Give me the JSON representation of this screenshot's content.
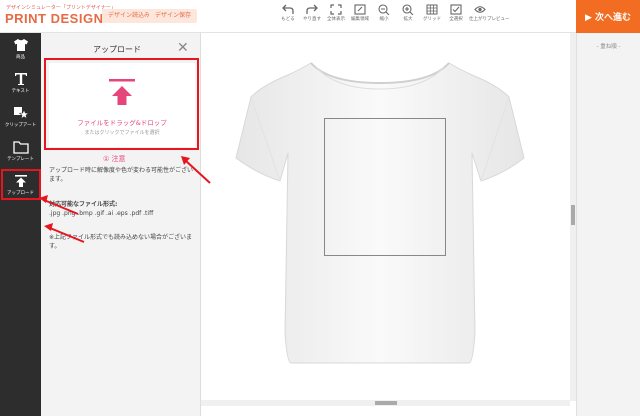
{
  "header": {
    "logo_sub": "デザインシミュレーター「プリントデザイナー」",
    "logo_main": "PRINT DESIGNER",
    "load_label": "デザイン読込み",
    "save_label": "デザイン保存",
    "next_label": "▶ 次へ進む"
  },
  "toolbar": [
    {
      "label": "もどる",
      "icon": "undo-icon"
    },
    {
      "label": "やり直す",
      "icon": "redo-icon"
    },
    {
      "label": "全体表示",
      "icon": "fit-icon"
    },
    {
      "label": "編集領域",
      "icon": "edit-area-icon"
    },
    {
      "label": "縮小",
      "icon": "zoom-out-icon"
    },
    {
      "label": "拡大",
      "icon": "zoom-in-icon"
    },
    {
      "label": "グリッド",
      "icon": "grid-icon"
    },
    {
      "label": "全選択",
      "icon": "select-all-icon"
    },
    {
      "label": "仕上がりプレビュー",
      "icon": "preview-icon"
    }
  ],
  "sidebar": {
    "items": [
      {
        "label": "商品",
        "icon": "tshirt-icon"
      },
      {
        "label": "テキスト",
        "icon": "text-icon"
      },
      {
        "label": "クリップアート",
        "icon": "clipart-icon"
      },
      {
        "label": "テンプレート",
        "icon": "folder-icon"
      },
      {
        "label": "アップロード",
        "icon": "upload-icon"
      }
    ]
  },
  "panel": {
    "title": "アップロード",
    "drop_title": "ファイルをドラッグ&ドロップ",
    "drop_sub": "またはクリックでファイルを選択",
    "notice_title": "① 注意",
    "notice_body": "アップロード時に解像度や色が変わる可能性がございます。",
    "formats_title": "対応可能なファイル形式:",
    "formats_list": ".jpg .png .bmp .gif .ai .eps .pdf .tiff",
    "formats_note": "※上記ファイル形式でも読み込めない場合がございます。"
  },
  "right_panel": {
    "label": "- 重ね順 -"
  },
  "colors": {
    "accent": "#f26c21",
    "brand": "#e76a43",
    "pink": "#e5457a",
    "sidebar": "#2d2d2d",
    "annotation_red": "#e5161d"
  }
}
